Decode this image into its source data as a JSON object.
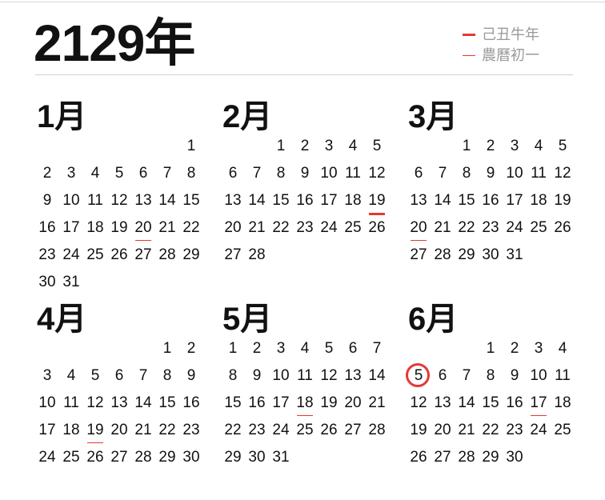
{
  "year_title": "2129年",
  "accent_color": "#e53935",
  "legend": [
    {
      "label": "己丑牛年",
      "mark": "thick"
    },
    {
      "label": "農曆初一",
      "mark": "thin"
    }
  ],
  "months": [
    {
      "name": "1月",
      "first_weekday": 6,
      "days": 31,
      "lunar_new_moon": [
        20
      ]
    },
    {
      "name": "2月",
      "first_weekday": 2,
      "days": 28,
      "lunar_year_start": [
        19
      ]
    },
    {
      "name": "3月",
      "first_weekday": 2,
      "days": 31,
      "lunar_new_moon": [
        20
      ]
    },
    {
      "name": "4月",
      "first_weekday": 5,
      "days": 30,
      "lunar_new_moon": [
        19
      ]
    },
    {
      "name": "5月",
      "first_weekday": 0,
      "days": 31,
      "lunar_new_moon": [
        18
      ]
    },
    {
      "name": "6月",
      "first_weekday": 3,
      "days": 30,
      "lunar_new_moon": [
        17
      ],
      "today": 5
    }
  ]
}
